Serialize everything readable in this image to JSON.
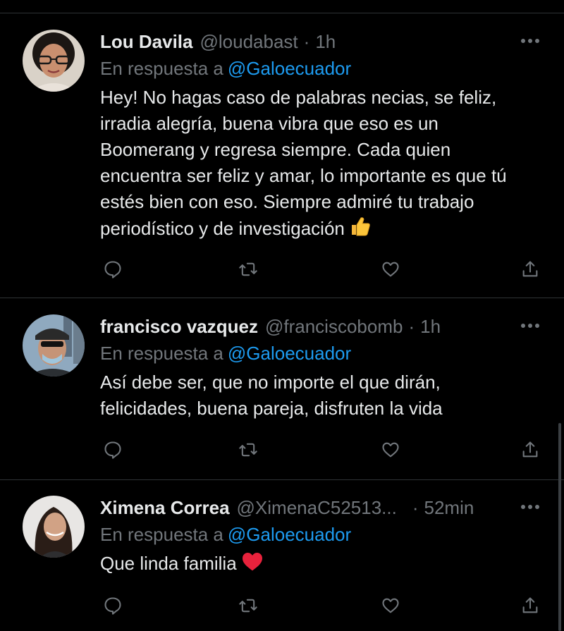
{
  "colors": {
    "background": "#000000",
    "text": "#e7e9ea",
    "secondary": "#71767b",
    "mention": "#1d9bf0",
    "divider": "#2f3336"
  },
  "tweets": [
    {
      "name": "Lou Davila",
      "handle": "@loudabast",
      "separator": "·",
      "time": "1h",
      "replying_label": "En respuesta a",
      "replying_to": "@Galoecuador",
      "body_lines": [
        "Hey! No hagas caso de palabras necias, se feliz,",
        "irradia alegría, buena vibra que eso es un",
        "Boomerang y regresa siempre. Cada quien",
        "encuentra ser feliz y amar, lo importante es que tú",
        "estés bien con eso. Siempre admiré tu trabajo",
        "periodístico y de investigación"
      ],
      "emoji": "thumbs-up-icon",
      "actions": [
        "reply-icon",
        "retweet-icon",
        "like-icon",
        "share-icon"
      ]
    },
    {
      "name": "francisco vazquez",
      "handle": "@franciscobomb",
      "separator": "·",
      "time": "1h",
      "replying_label": "En respuesta a",
      "replying_to": "@Galoecuador",
      "body_lines": [
        "Así debe ser, que no importe el que dirán,",
        "felicidades, buena pareja, disfruten la vida"
      ],
      "actions": [
        "reply-icon",
        "retweet-icon",
        "like-icon",
        "share-icon"
      ]
    },
    {
      "name": "Ximena Correa",
      "handle": "@XimenaC52513...",
      "separator": "·",
      "time": "52min",
      "replying_label": "En respuesta a",
      "replying_to": "@Galoecuador",
      "body_lines": [
        "Que linda familia"
      ],
      "emoji": "red-heart-icon",
      "actions": [
        "reply-icon",
        "retweet-icon",
        "like-icon",
        "share-icon"
      ]
    }
  ]
}
